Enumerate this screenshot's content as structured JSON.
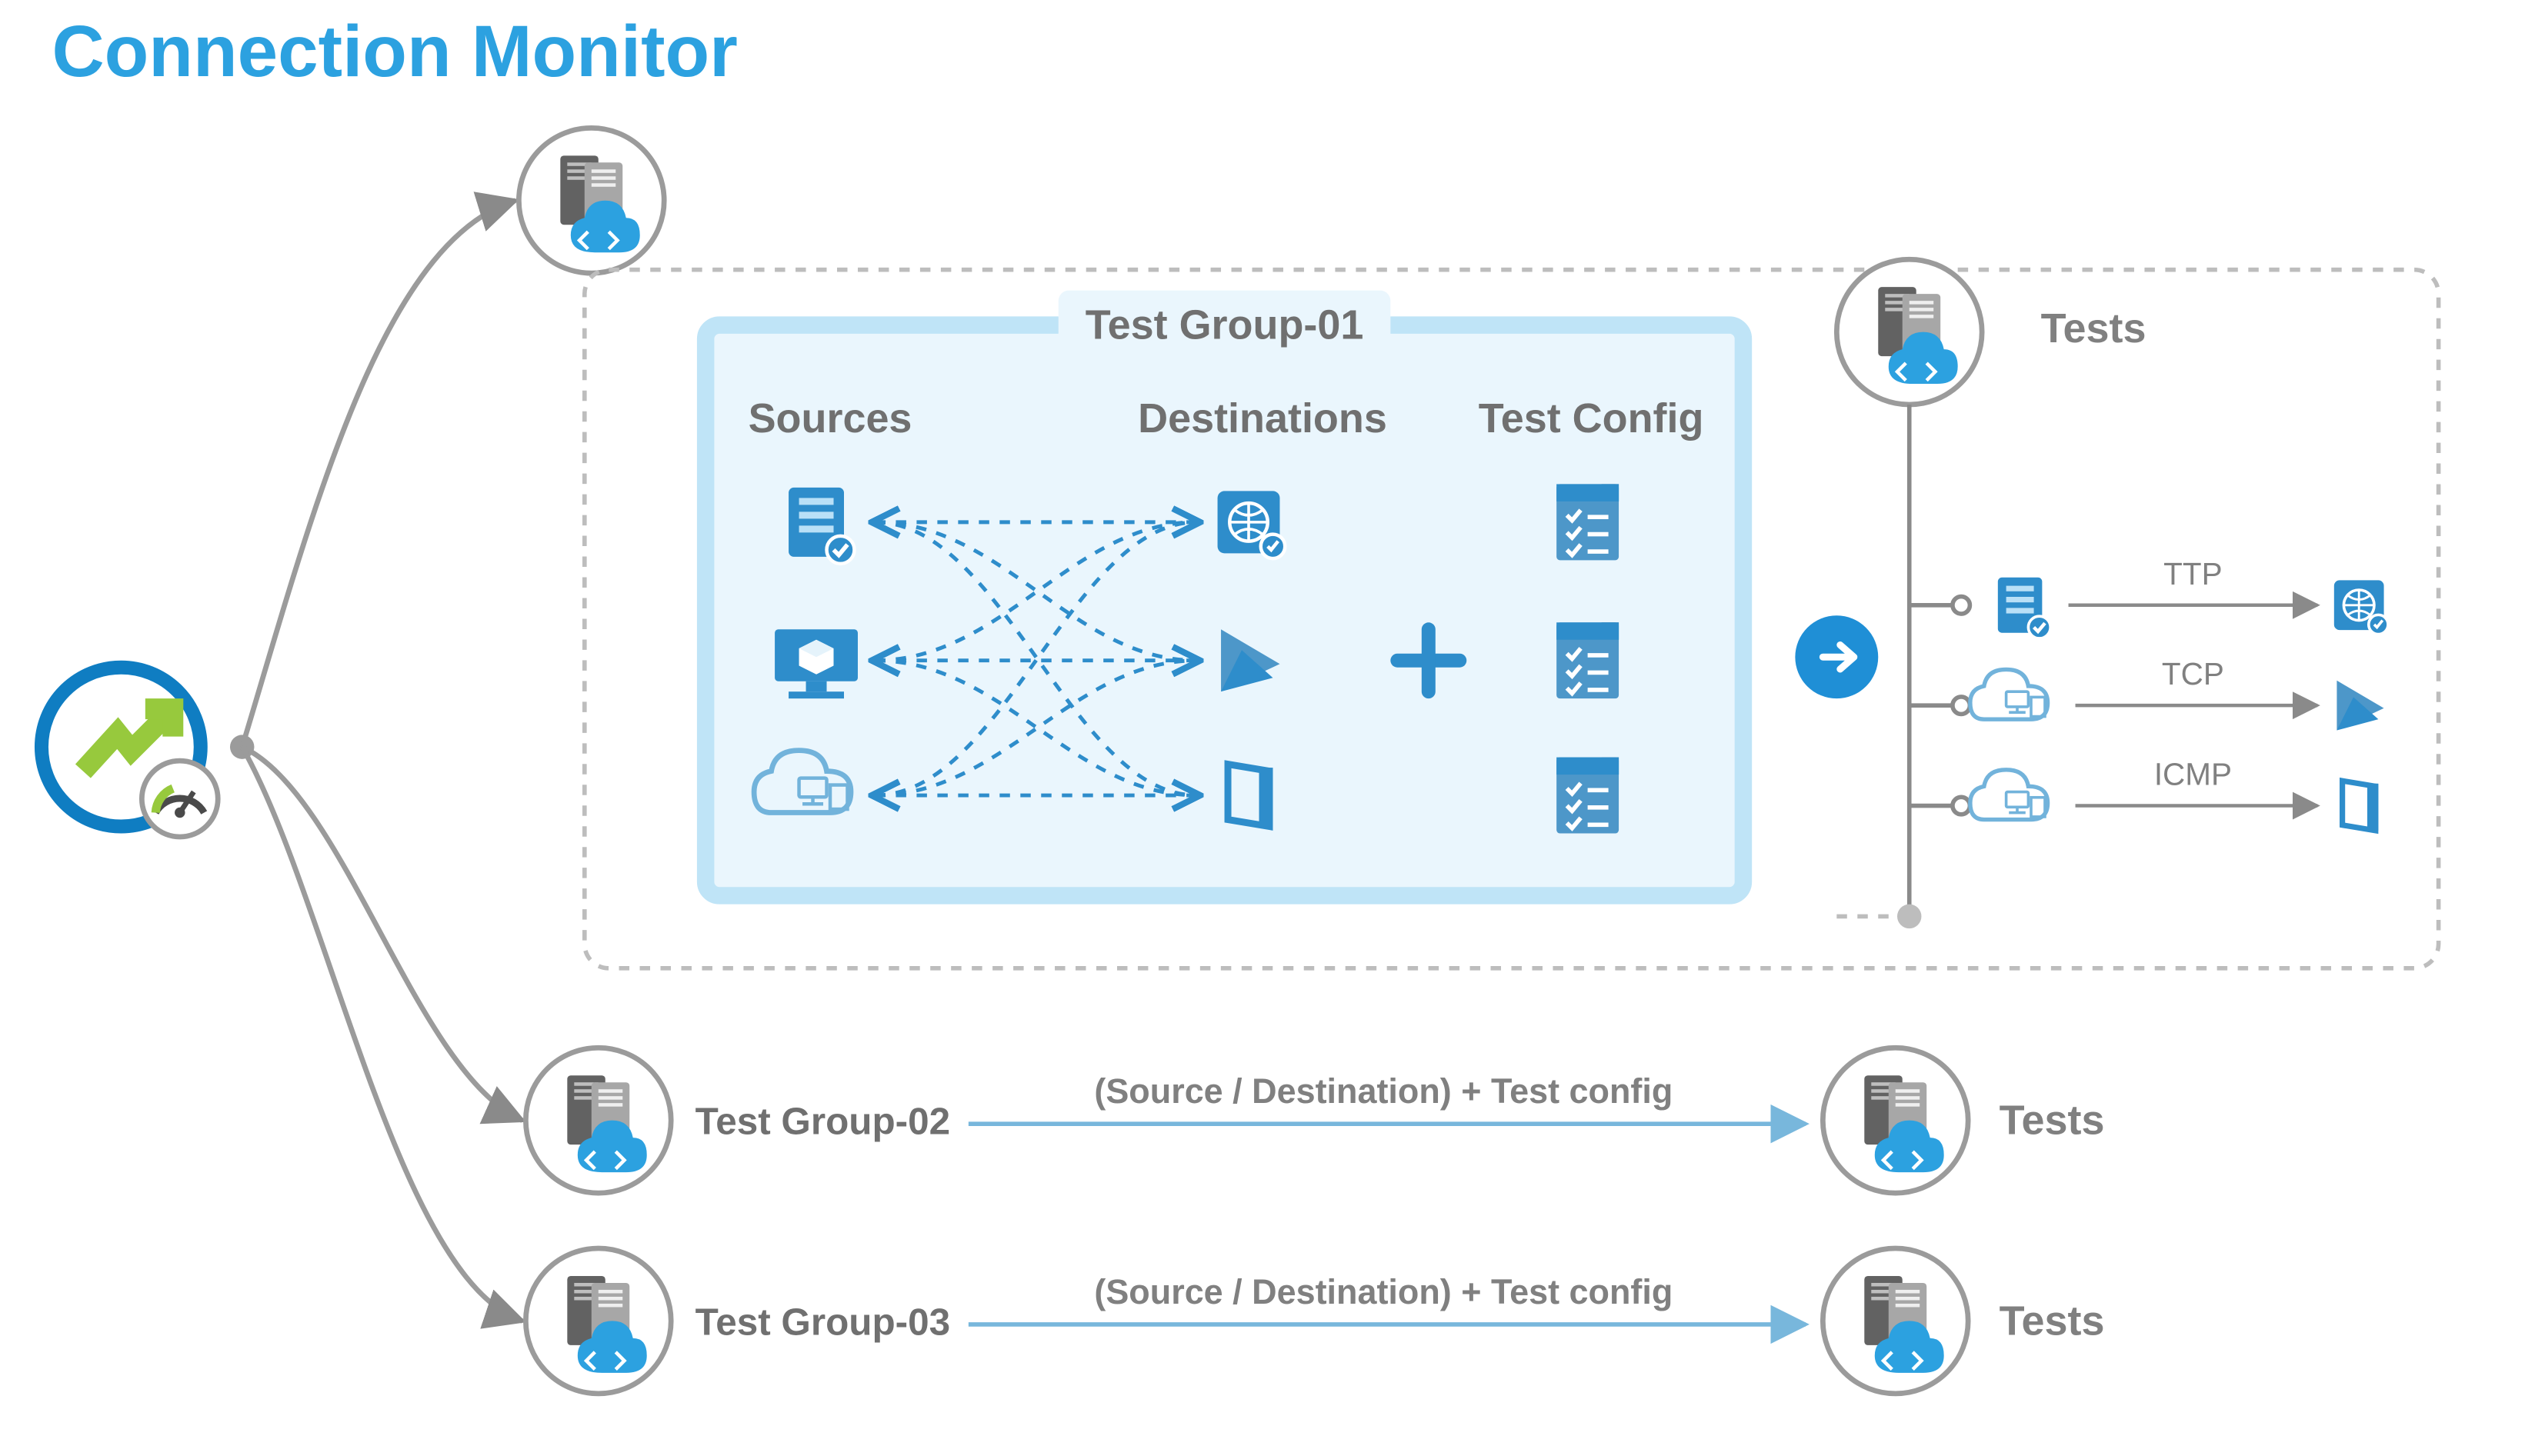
{
  "title": "Connection Monitor",
  "test_group_panel": {
    "tab": "Test Group-01",
    "columns": {
      "sources": "Sources",
      "destinations": "Destinations",
      "testconfig": "Test Config"
    }
  },
  "tests_header": "Tests",
  "test_rows": [
    {
      "protocol": "TTP"
    },
    {
      "protocol": "TCP"
    },
    {
      "protocol": "ICMP"
    }
  ],
  "other_groups": [
    {
      "name": "Test Group-02",
      "middle": "(Source / Destination) + Test config",
      "right": "Tests"
    },
    {
      "name": "Test Group-03",
      "middle": "(Source / Destination) + Test config",
      "right": "Tests"
    }
  ]
}
